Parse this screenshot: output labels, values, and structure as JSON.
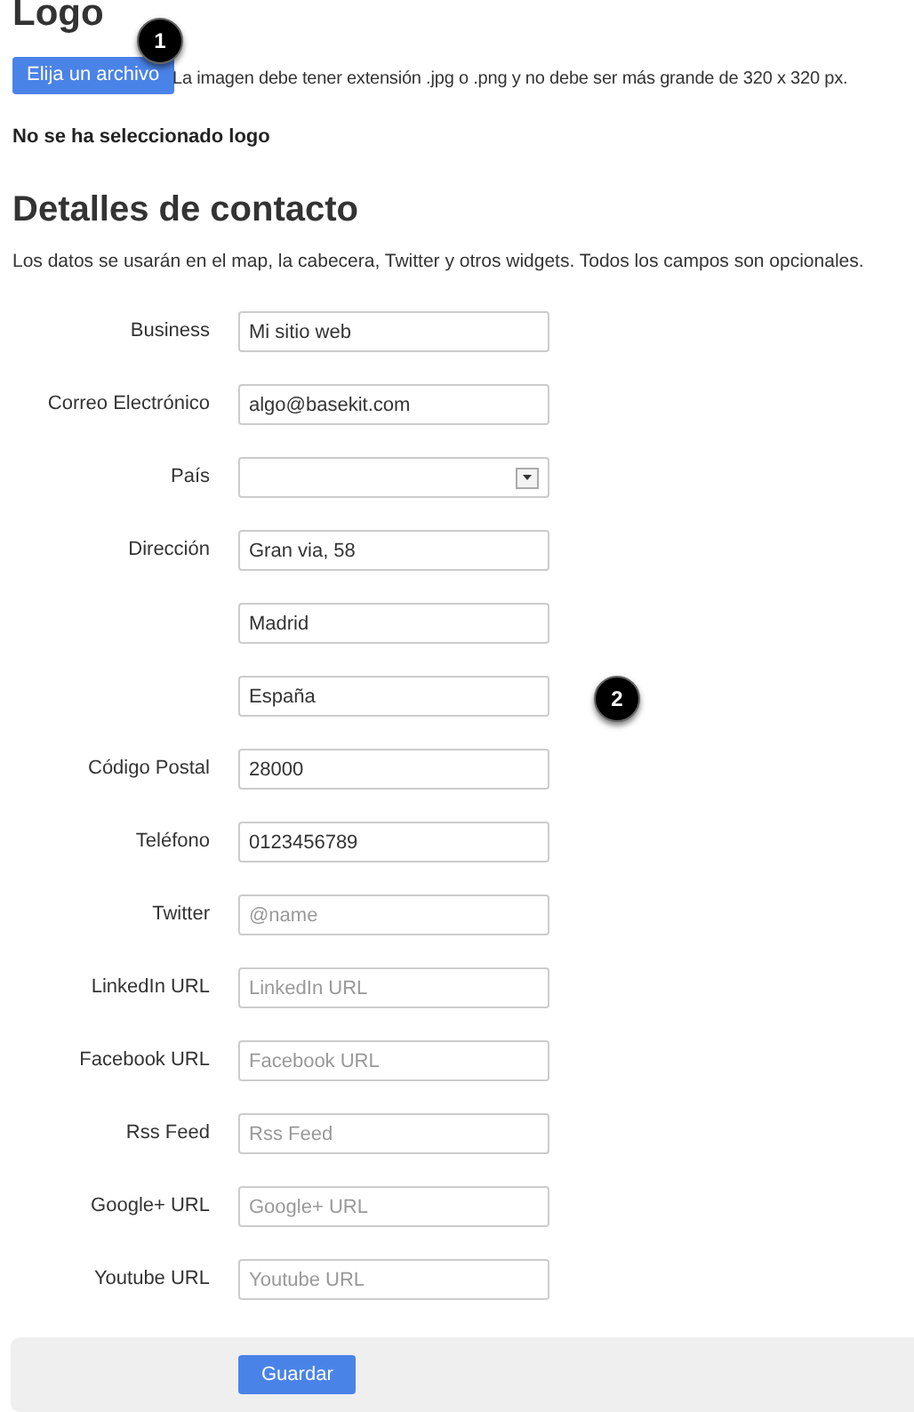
{
  "logo": {
    "heading": "Logo",
    "upload_button": "Elija un archivo",
    "hint": "La imagen debe tener extensión .jpg o .png y no debe ser más grande de 320 x 320 px.",
    "status": "No se ha seleccionado logo"
  },
  "contact": {
    "heading": "Detalles de contacto",
    "description": "Los datos se usarán en el map, la cabecera, Twitter y otros widgets. Todos los campos son opcionales.",
    "fields": [
      {
        "label": "Business",
        "kind": "text",
        "value": "Mi sitio web"
      },
      {
        "label": "Correo Electrónico",
        "kind": "text",
        "value": "algo@basekit.com"
      },
      {
        "label": "País",
        "kind": "select"
      },
      {
        "label": "Dirección",
        "kind": "text",
        "value": "Gran via, 58"
      },
      {
        "kind": "text",
        "value": "Madrid"
      },
      {
        "kind": "text",
        "value": "España"
      },
      {
        "label": "Código Postal",
        "kind": "text",
        "value": "28000"
      },
      {
        "label": "Teléfono",
        "kind": "text",
        "value": "0123456789"
      },
      {
        "label": "Twitter",
        "kind": "text",
        "placeholder": "@name"
      },
      {
        "label": "LinkedIn URL",
        "kind": "text",
        "placeholder": "LinkedIn URL"
      },
      {
        "label": "Facebook URL",
        "kind": "text",
        "placeholder": "Facebook URL"
      },
      {
        "label": "Rss Feed",
        "kind": "text",
        "placeholder": "Rss Feed"
      },
      {
        "label": "Google+ URL",
        "kind": "text",
        "placeholder": "Google+ URL"
      },
      {
        "label": "Youtube URL",
        "kind": "text",
        "placeholder": "Youtube URL"
      }
    ]
  },
  "save_button": "Guardar",
  "callouts": [
    "1",
    "2"
  ]
}
